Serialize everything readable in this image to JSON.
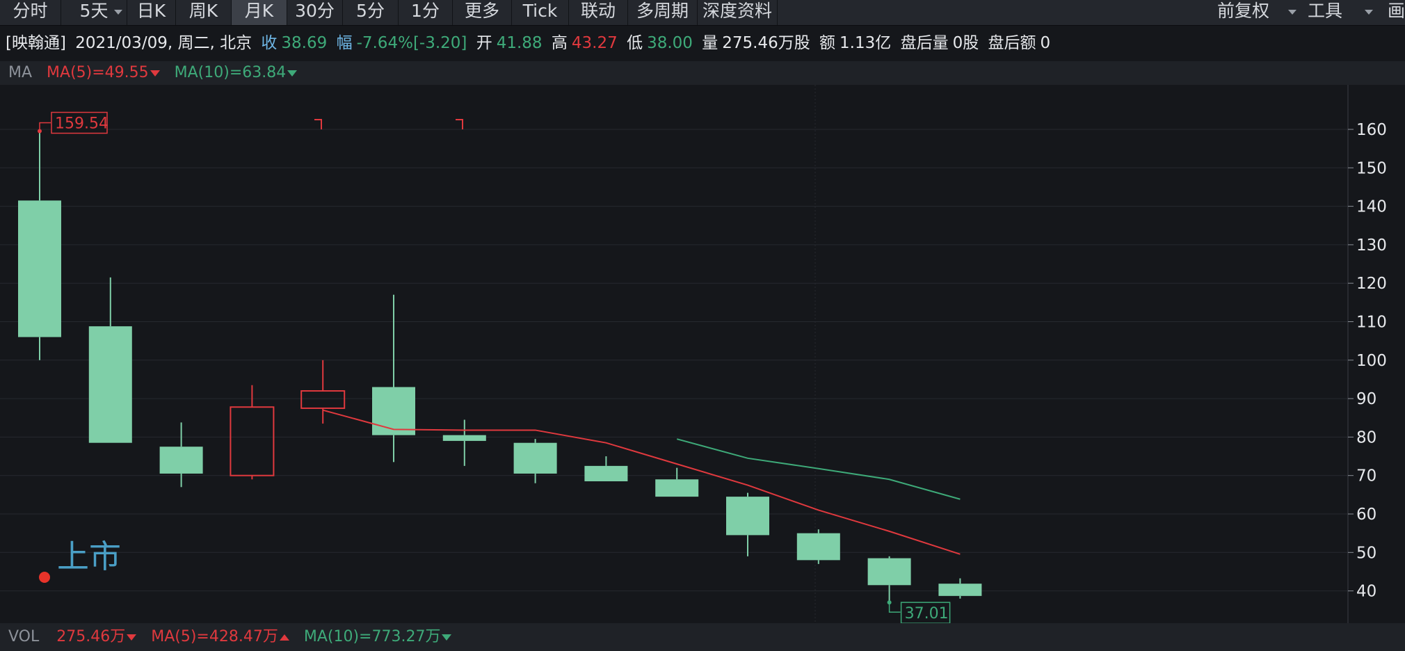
{
  "toolbar": {
    "tabs": [
      "分时",
      "5天",
      "日K",
      "周K",
      "月K",
      "30分",
      "5分",
      "1分",
      "更多",
      "Tick",
      "联动",
      "多周期",
      "深度资料"
    ],
    "active_tab": "月K",
    "right": [
      "前复权",
      "工具",
      "画线"
    ]
  },
  "info": {
    "name": "[映翰通]",
    "date": "2021/03/09, 周二, 北京",
    "close_label": "收",
    "close": "38.69",
    "change_label": "幅",
    "change_pct": "-7.64%",
    "change_abs": "[-3.20]",
    "open_label": "开",
    "open": "41.88",
    "high_label": "高",
    "high": "43.27",
    "low_label": "低",
    "low": "38.00",
    "volume_label": "量",
    "volume": "275.46万股",
    "amount_label": "额",
    "amount": "1.13亿",
    "after_vol_label": "盘后量",
    "after_vol": "0股",
    "after_amt_label": "盘后额",
    "after_amt": "0"
  },
  "ma_bar": {
    "label": "MA",
    "ma5": "MA(5)=49.55",
    "ma10": "MA(10)=63.84"
  },
  "vol_bar": {
    "label": "VOL",
    "vol": "275.46万",
    "ma5": "MA(5)=428.47万",
    "ma10": "MA(10)=773.27万"
  },
  "colors": {
    "up": "#e0393e",
    "down": "#7fcfa8",
    "ma5": "#e0393e",
    "ma10": "#3eaa79",
    "grid": "#26292f",
    "label_blue": "#4a9fc6"
  },
  "chart_data": {
    "type": "candlestick",
    "y_ticks": [
      160,
      150,
      140,
      130,
      120,
      110,
      100,
      90,
      80,
      70,
      60,
      50,
      40
    ],
    "ylim": [
      33,
      172
    ],
    "candles": [
      {
        "open": 141.5,
        "close": 106.0,
        "high": 159.54,
        "low": 100.0
      },
      {
        "open": 108.8,
        "close": 78.5,
        "high": 121.5,
        "low": 78.5
      },
      {
        "open": 77.5,
        "close": 70.5,
        "high": 83.8,
        "low": 67.0
      },
      {
        "open": 70.0,
        "close": 87.8,
        "high": 93.5,
        "low": 69.0
      },
      {
        "open": 87.5,
        "close": 92.0,
        "high": 100.0,
        "low": 83.5
      },
      {
        "open": 93.0,
        "close": 80.5,
        "high": 117.0,
        "low": 73.5
      },
      {
        "open": 80.5,
        "close": 79.0,
        "high": 84.5,
        "low": 72.5
      },
      {
        "open": 78.5,
        "close": 70.5,
        "high": 79.5,
        "low": 68.0
      },
      {
        "open": 72.5,
        "close": 68.5,
        "high": 75.0,
        "low": 68.5
      },
      {
        "open": 69.0,
        "close": 64.5,
        "high": 72.0,
        "low": 64.5
      },
      {
        "open": 64.5,
        "close": 54.5,
        "high": 65.5,
        "low": 49.0
      },
      {
        "open": 55.0,
        "close": 48.0,
        "high": 56.0,
        "low": 47.0
      },
      {
        "open": 48.5,
        "close": 41.5,
        "high": 49.0,
        "low": 37.01
      },
      {
        "open": 41.88,
        "close": 38.69,
        "high": 43.27,
        "low": 38.0
      }
    ],
    "ma5": [
      null,
      null,
      null,
      null,
      87.0,
      82.0,
      81.8,
      81.8,
      78.5,
      73.0,
      67.5,
      61.0,
      55.5,
      49.55
    ],
    "ma10": [
      null,
      null,
      null,
      null,
      null,
      null,
      null,
      null,
      null,
      79.5,
      74.5,
      71.8,
      69.0,
      63.84
    ],
    "high_label": "159.54",
    "low_label": "37.01",
    "listing_label": "上市"
  }
}
